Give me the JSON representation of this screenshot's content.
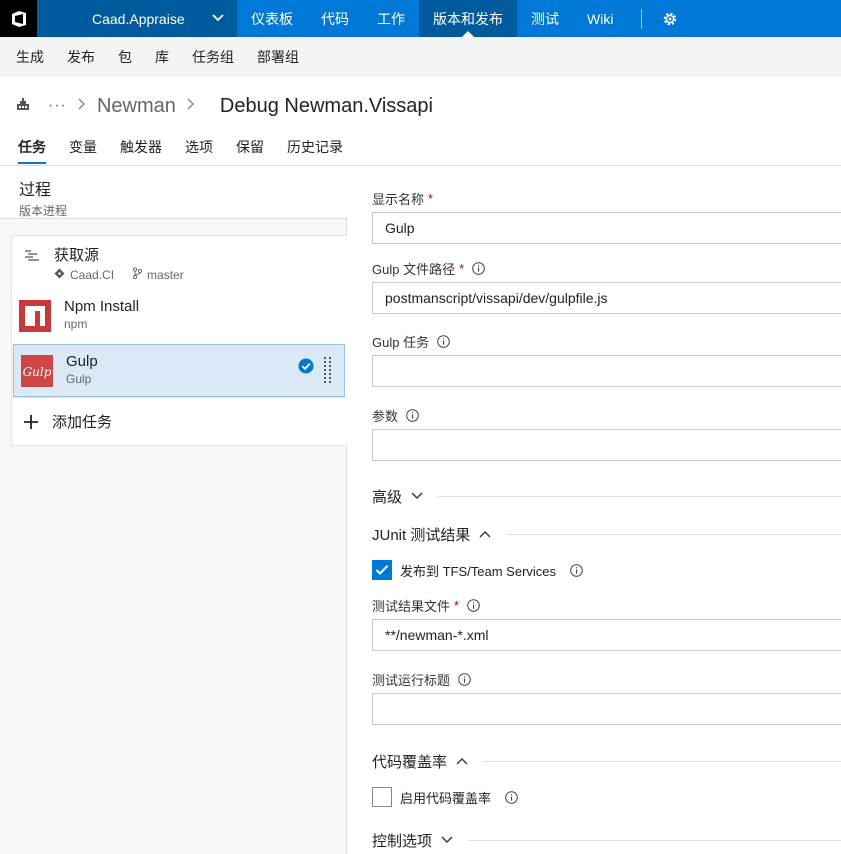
{
  "topbar": {
    "project": "Caad.Appraise",
    "nav": [
      "仪表板",
      "代码",
      "工作",
      "版本和发布",
      "测试",
      "Wiki"
    ],
    "active_index": 3
  },
  "subnav": [
    "生成",
    "发布",
    "包",
    "库",
    "任务组",
    "部署组"
  ],
  "breadcrumb": {
    "dots": "···",
    "parent": "Newman",
    "title": "Debug Newman.Vissapi"
  },
  "tabs": [
    "任务",
    "变量",
    "触发器",
    "选项",
    "保留",
    "历史记录"
  ],
  "process": {
    "title": "过程",
    "subtitle": "版本进程"
  },
  "tasks": [
    {
      "name": "获取源",
      "repo": "Caad.CI",
      "branch": "master"
    },
    {
      "name": "Npm Install",
      "sub": "npm"
    },
    {
      "name": "Gulp",
      "sub": "Gulp",
      "logo_text": "Gulp"
    }
  ],
  "add_task": "添加任务",
  "form": {
    "display_name_label": "显示名称",
    "display_name_value": "Gulp",
    "gulpfile_label": "Gulp 文件路径",
    "gulpfile_value": "postmanscript/vissapi/dev/gulpfile.js",
    "gulp_tasks_label": "Gulp 任务",
    "gulp_tasks_value": "",
    "args_label": "参数",
    "args_value": "",
    "advanced": "高级",
    "junit": "JUnit 测试结果",
    "publish_label": "发布到 TFS/Team Services",
    "publish_checked": true,
    "test_results_label": "测试结果文件",
    "test_results_value": "**/newman-*.xml",
    "test_run_title_label": "测试运行标题",
    "test_run_title_value": "",
    "coverage": "代码覆盖率",
    "coverage_label": "启用代码覆盖率",
    "coverage_checked": false,
    "control": "控制选项",
    "required_mark": "*"
  },
  "colors": {
    "brand": "#0078d7",
    "topbar_dark": "#005a9e",
    "npm_red": "#cb3837",
    "gulp_red": "#cf4647"
  }
}
